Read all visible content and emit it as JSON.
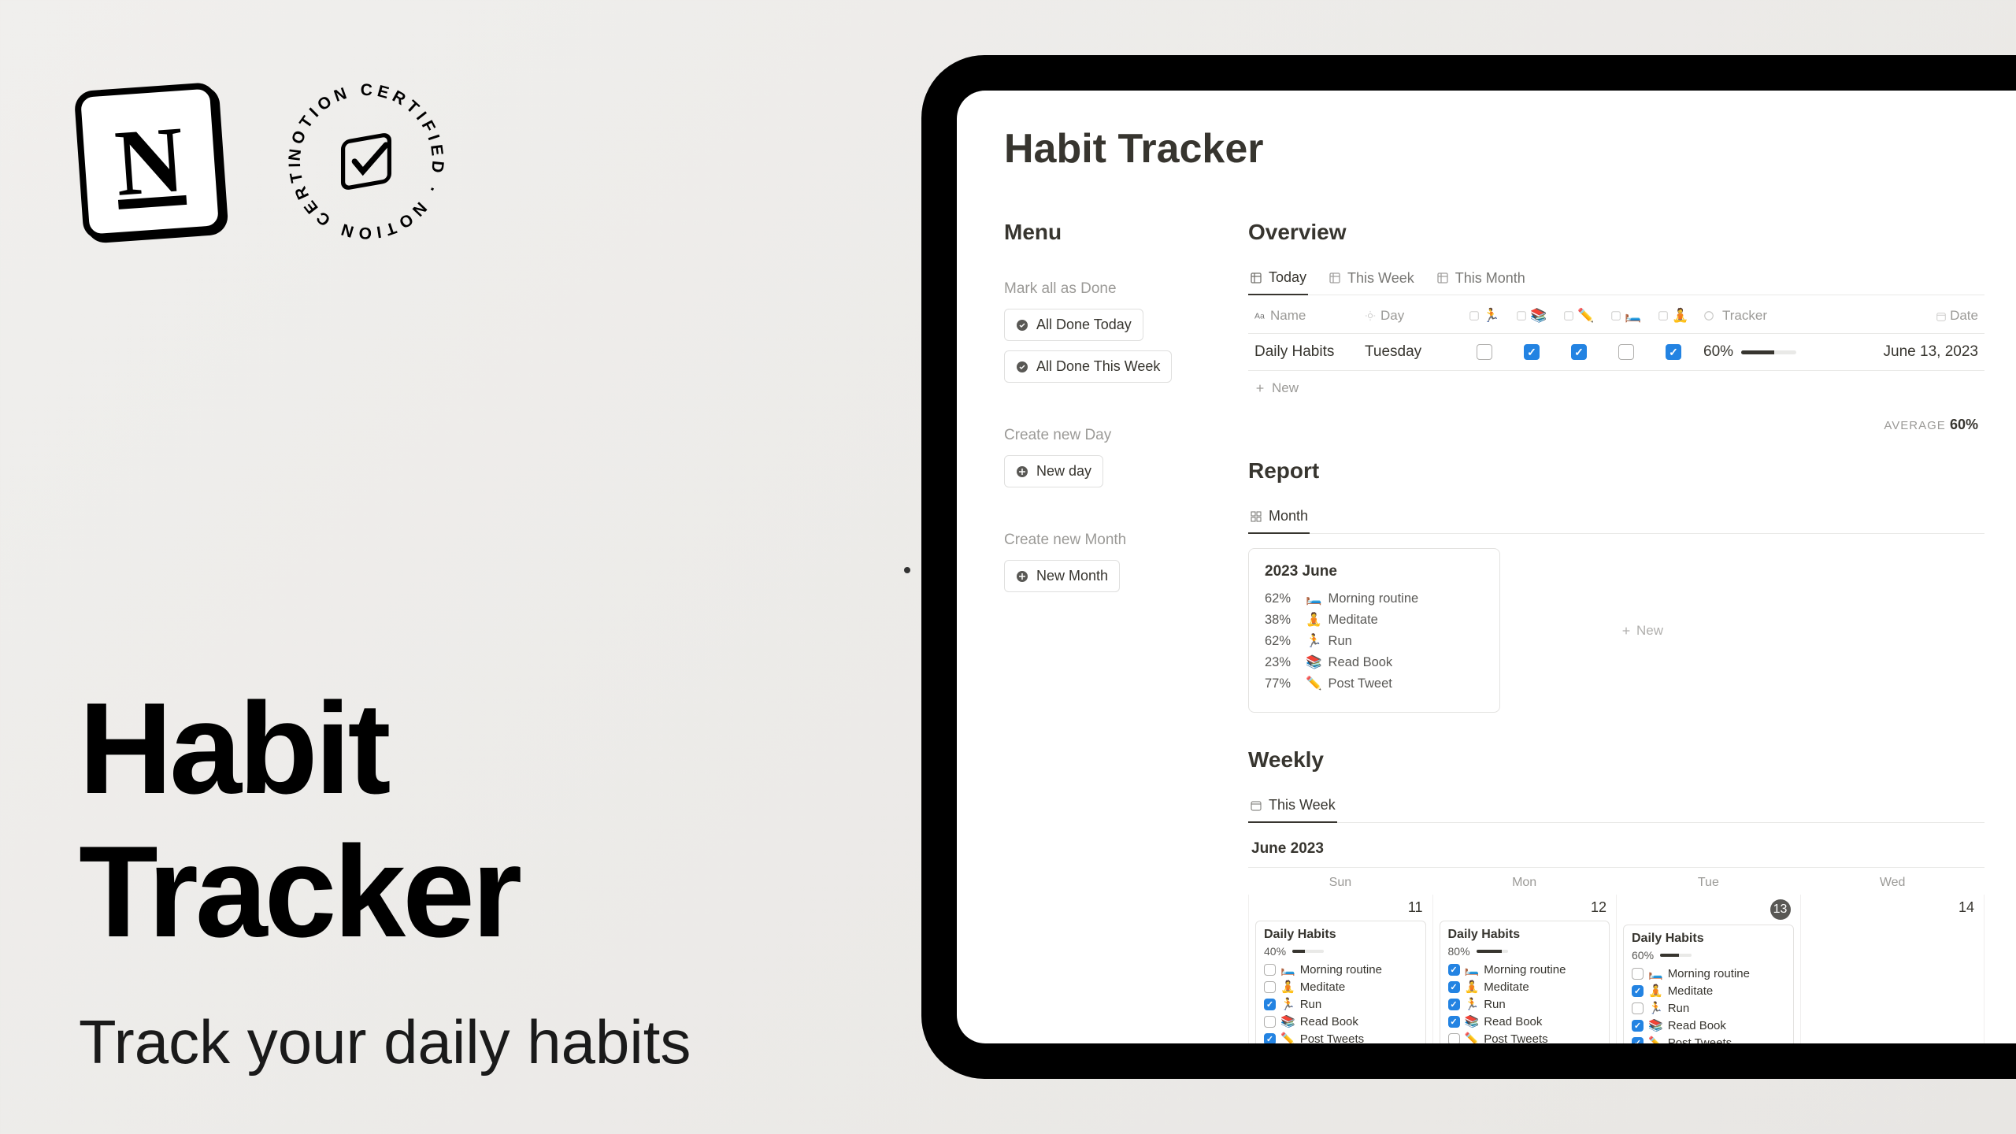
{
  "promo": {
    "title": "Habit Tracker",
    "subtitle": "Track your daily habits"
  },
  "app": {
    "title": "Habit Tracker",
    "menu": {
      "heading": "Menu",
      "mark_all_label": "Mark all as Done",
      "all_done_today": "All Done Today",
      "all_done_week": "All Done This Week",
      "create_day_label": "Create new Day",
      "new_day": "New day",
      "create_month_label": "Create new Month",
      "new_month": "New Month"
    },
    "overview": {
      "heading": "Overview",
      "tabs": [
        "Today",
        "This Week",
        "This Month"
      ],
      "active_tab": 0,
      "columns": {
        "name": "Name",
        "day": "Day",
        "tracker": "Tracker",
        "date": "Date"
      },
      "row": {
        "name": "Daily Habits",
        "day": "Tuesday",
        "checks": [
          false,
          true,
          true,
          false,
          true
        ],
        "tracker_pct": "60%",
        "tracker_val": 60,
        "date": "June 13, 2023"
      },
      "new_label": "New",
      "average_label": "AVERAGE",
      "average_value": "60%"
    },
    "report": {
      "heading": "Report",
      "tab": "Month",
      "card": {
        "title": "2023 June",
        "items": [
          {
            "pct": "62%",
            "icon": "🛏️",
            "label": "Morning routine"
          },
          {
            "pct": "38%",
            "icon": "🧘",
            "label": "Meditate"
          },
          {
            "pct": "62%",
            "icon": "🏃",
            "label": "Run"
          },
          {
            "pct": "23%",
            "icon": "📚",
            "label": "Read Book"
          },
          {
            "pct": "77%",
            "icon": "✏️",
            "label": "Post Tweet"
          }
        ]
      },
      "new_label": "New"
    },
    "weekly": {
      "heading": "Weekly",
      "tab": "This Week",
      "month_label": "June 2023",
      "weekdays": [
        "Sun",
        "Mon",
        "Tue",
        "Wed"
      ],
      "days": [
        {
          "date": "11",
          "today": false,
          "title": "Daily Habits",
          "pct": "40%",
          "val": 40,
          "items": [
            {
              "checked": false,
              "icon": "🛏️",
              "label": "Morning routine"
            },
            {
              "checked": false,
              "icon": "🧘",
              "label": "Meditate"
            },
            {
              "checked": true,
              "icon": "🏃",
              "label": "Run"
            },
            {
              "checked": false,
              "icon": "📚",
              "label": "Read Book"
            },
            {
              "checked": true,
              "icon": "✏️",
              "label": "Post Tweets"
            }
          ]
        },
        {
          "date": "12",
          "today": false,
          "title": "Daily Habits",
          "pct": "80%",
          "val": 80,
          "items": [
            {
              "checked": true,
              "icon": "🛏️",
              "label": "Morning routine"
            },
            {
              "checked": true,
              "icon": "🧘",
              "label": "Meditate"
            },
            {
              "checked": true,
              "icon": "🏃",
              "label": "Run"
            },
            {
              "checked": true,
              "icon": "📚",
              "label": "Read Book"
            },
            {
              "checked": false,
              "icon": "✏️",
              "label": "Post Tweets"
            }
          ]
        },
        {
          "date": "13",
          "today": true,
          "title": "Daily Habits",
          "pct": "60%",
          "val": 60,
          "items": [
            {
              "checked": false,
              "icon": "🛏️",
              "label": "Morning routine"
            },
            {
              "checked": true,
              "icon": "🧘",
              "label": "Meditate"
            },
            {
              "checked": false,
              "icon": "🏃",
              "label": "Run"
            },
            {
              "checked": true,
              "icon": "📚",
              "label": "Read Book"
            },
            {
              "checked": true,
              "icon": "✏️",
              "label": "Post Tweets"
            }
          ]
        },
        {
          "date": "14",
          "today": false
        }
      ]
    }
  }
}
